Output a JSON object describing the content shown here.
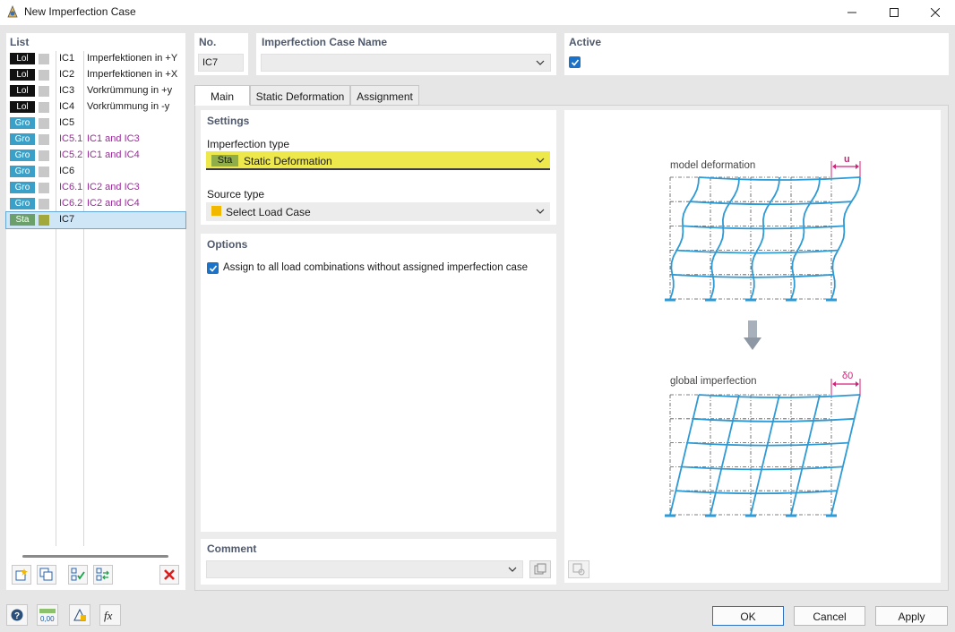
{
  "window": {
    "title": "New Imperfection Case"
  },
  "list": {
    "header": "List",
    "items": [
      {
        "badge": "Lol",
        "badge_color": "#111111",
        "swatch_color": "#c8c8c8",
        "no": "IC1",
        "desc": "Imperfektionen in +Y",
        "no_color": "#1a1a1a",
        "desc_color": "#1a1a1a"
      },
      {
        "badge": "Lol",
        "badge_color": "#111111",
        "swatch_color": "#c8c8c8",
        "no": "IC2",
        "desc": "Imperfektionen in +X",
        "no_color": "#1a1a1a",
        "desc_color": "#1a1a1a"
      },
      {
        "badge": "Lol",
        "badge_color": "#111111",
        "swatch_color": "#c8c8c8",
        "no": "IC3",
        "desc": "Vorkrümmung in +y",
        "no_color": "#1a1a1a",
        "desc_color": "#1a1a1a"
      },
      {
        "badge": "Lol",
        "badge_color": "#111111",
        "swatch_color": "#c8c8c8",
        "no": "IC4",
        "desc": "Vorkrümmung in -y",
        "no_color": "#1a1a1a",
        "desc_color": "#1a1a1a"
      },
      {
        "badge": "Gro",
        "badge_color": "#3aa0c8",
        "swatch_color": "#c8c8c8",
        "no": "IC5",
        "desc": "",
        "no_color": "#1a1a1a",
        "desc_color": "#1a1a1a"
      },
      {
        "badge": "Gro",
        "badge_color": "#3aa0c8",
        "swatch_color": "#c8c8c8",
        "no": "IC5.1",
        "desc": "IC1 and IC3",
        "no_color": "#9b2a9b",
        "desc_color": "#9b2a9b"
      },
      {
        "badge": "Gro",
        "badge_color": "#3aa0c8",
        "swatch_color": "#c8c8c8",
        "no": "IC5.2",
        "desc": "IC1 and IC4",
        "no_color": "#9b2a9b",
        "desc_color": "#9b2a9b"
      },
      {
        "badge": "Gro",
        "badge_color": "#3aa0c8",
        "swatch_color": "#c8c8c8",
        "no": "IC6",
        "desc": "",
        "no_color": "#1a1a1a",
        "desc_color": "#1a1a1a"
      },
      {
        "badge": "Gro",
        "badge_color": "#3aa0c8",
        "swatch_color": "#c8c8c8",
        "no": "IC6.1",
        "desc": "IC2 and IC3",
        "no_color": "#9b2a9b",
        "desc_color": "#9b2a9b"
      },
      {
        "badge": "Gro",
        "badge_color": "#3aa0c8",
        "swatch_color": "#c8c8c8",
        "no": "IC6.2",
        "desc": "IC2 and IC4",
        "no_color": "#9b2a9b",
        "desc_color": "#9b2a9b"
      },
      {
        "badge": "Sta",
        "badge_color": "#6ba06b",
        "swatch_color": "#a3a83a",
        "no": "IC7",
        "desc": "",
        "no_color": "#1a1a1a",
        "desc_color": "#1a1a1a",
        "selected": true
      }
    ]
  },
  "header_fields": {
    "no_label": "No.",
    "no_value": "IC7",
    "name_label": "Imperfection Case Name",
    "name_value": "",
    "active_label": "Active"
  },
  "tabs": [
    {
      "label": "Main",
      "active": true
    },
    {
      "label": "Static Deformation",
      "active": false
    },
    {
      "label": "Assignment",
      "active": false
    }
  ],
  "settings": {
    "header": "Settings",
    "imperfection_type_label": "Imperfection type",
    "imperfection_type_badge": "Sta",
    "imperfection_type_value": "Static Deformation",
    "source_type_label": "Source type",
    "source_type_value": "Select Load Case"
  },
  "options": {
    "header": "Options",
    "assign_all_label": "Assign to all load combinations without assigned imperfection case"
  },
  "comment": {
    "header": "Comment",
    "value": ""
  },
  "figure": {
    "top_label": "model deformation",
    "top_dim": "u",
    "bottom_label": "global imperfection",
    "bottom_dim": "δ0"
  },
  "buttons": {
    "ok": "OK",
    "cancel": "Cancel",
    "apply": "Apply"
  },
  "colors": {
    "accent": "#1a73c8",
    "highlight": "#ede84c",
    "frame": "#2e9ad6",
    "dim": "#d2237a"
  }
}
